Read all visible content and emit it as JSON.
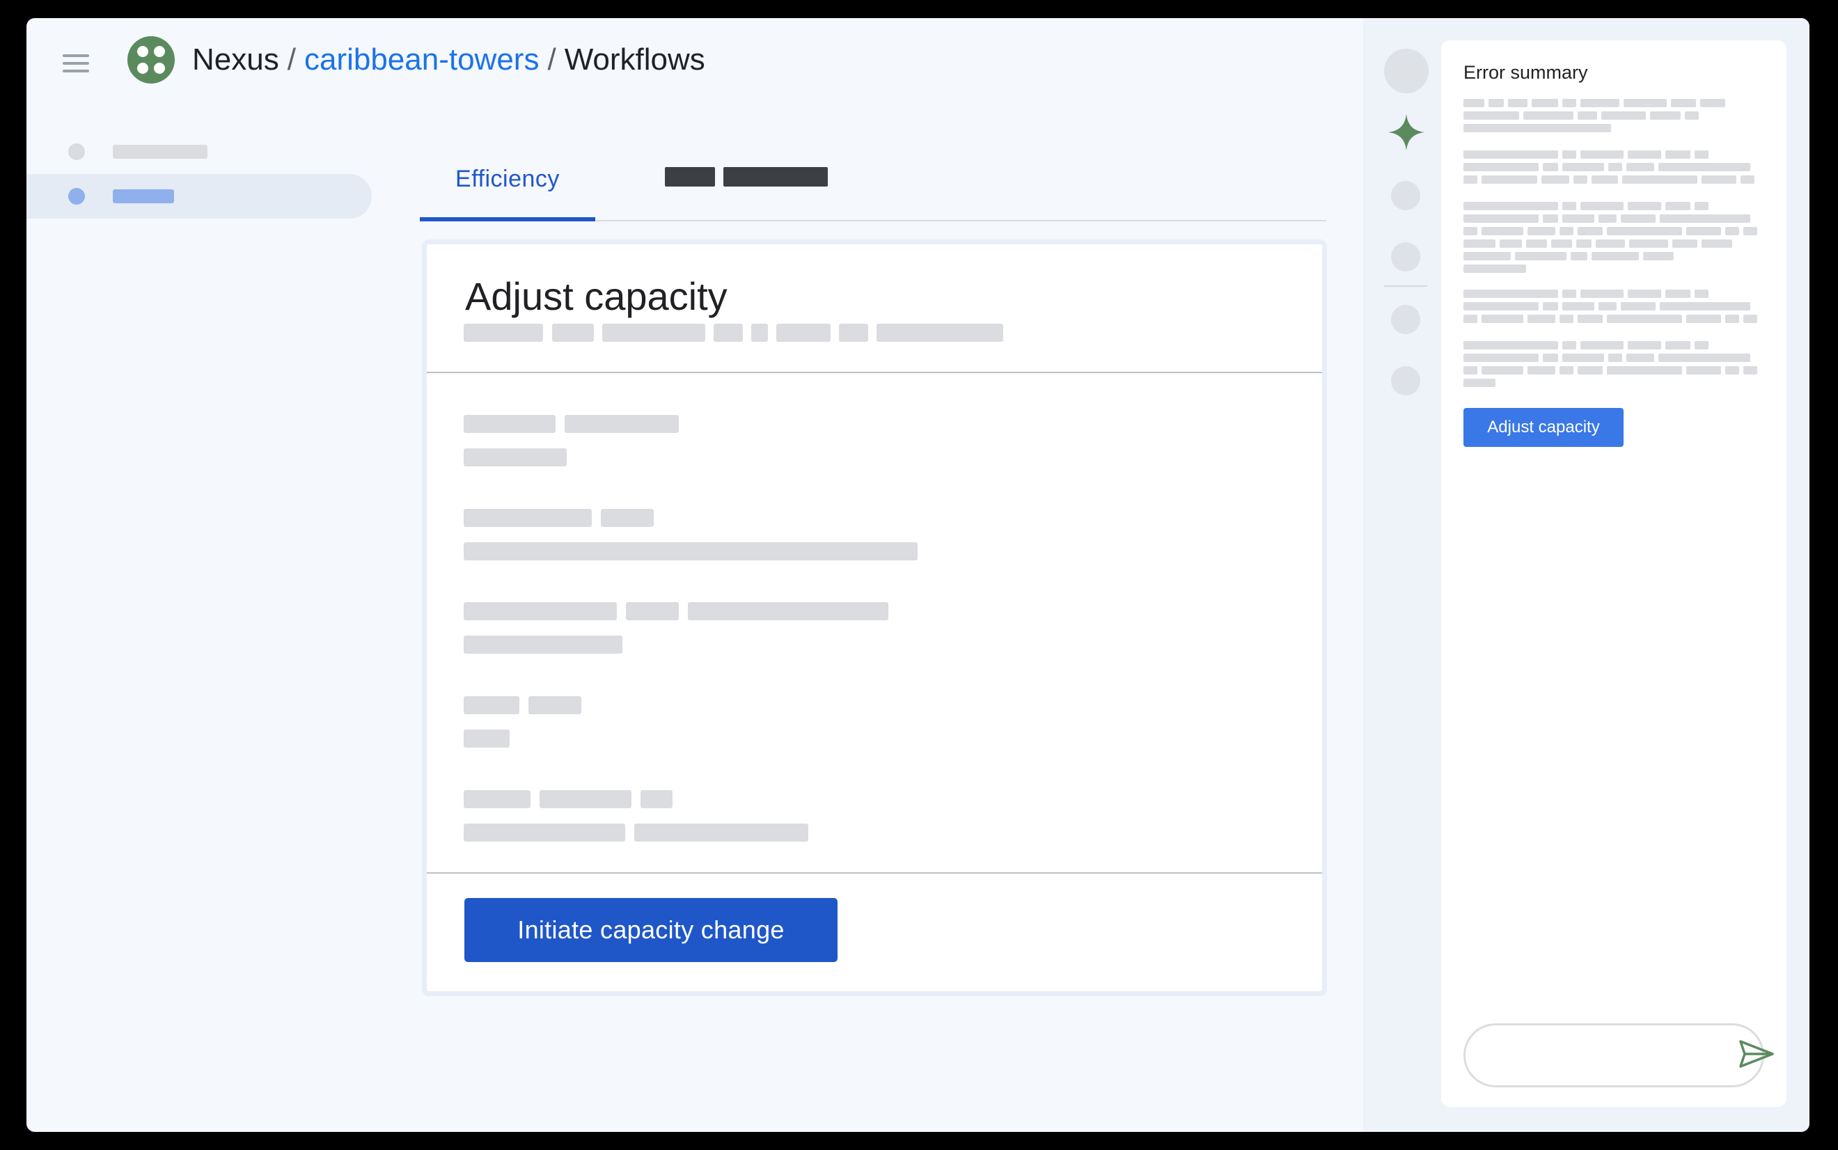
{
  "header": {
    "app_name": "Nexus",
    "separator": "/",
    "project": "caribbean-towers",
    "page": "Workflows"
  },
  "tabs": {
    "active_label": "Efficiency"
  },
  "card": {
    "title": "Adjust capacity",
    "primary_action": "Initiate capacity change"
  },
  "side_panel": {
    "title": "Error summary",
    "action_label": "Adjust capacity",
    "chat_placeholder": ""
  },
  "icons": {
    "menu": "hamburger-menu-icon",
    "logo": "nexus-logo-icon",
    "assistant": "sparkle-icon",
    "send": "send-icon"
  },
  "colors": {
    "accent": "#1f57c8",
    "link": "#1a73e8",
    "panel_button": "#3b78e7",
    "sparkle": "#5b8a5e",
    "logo": "#5b8a5e"
  }
}
